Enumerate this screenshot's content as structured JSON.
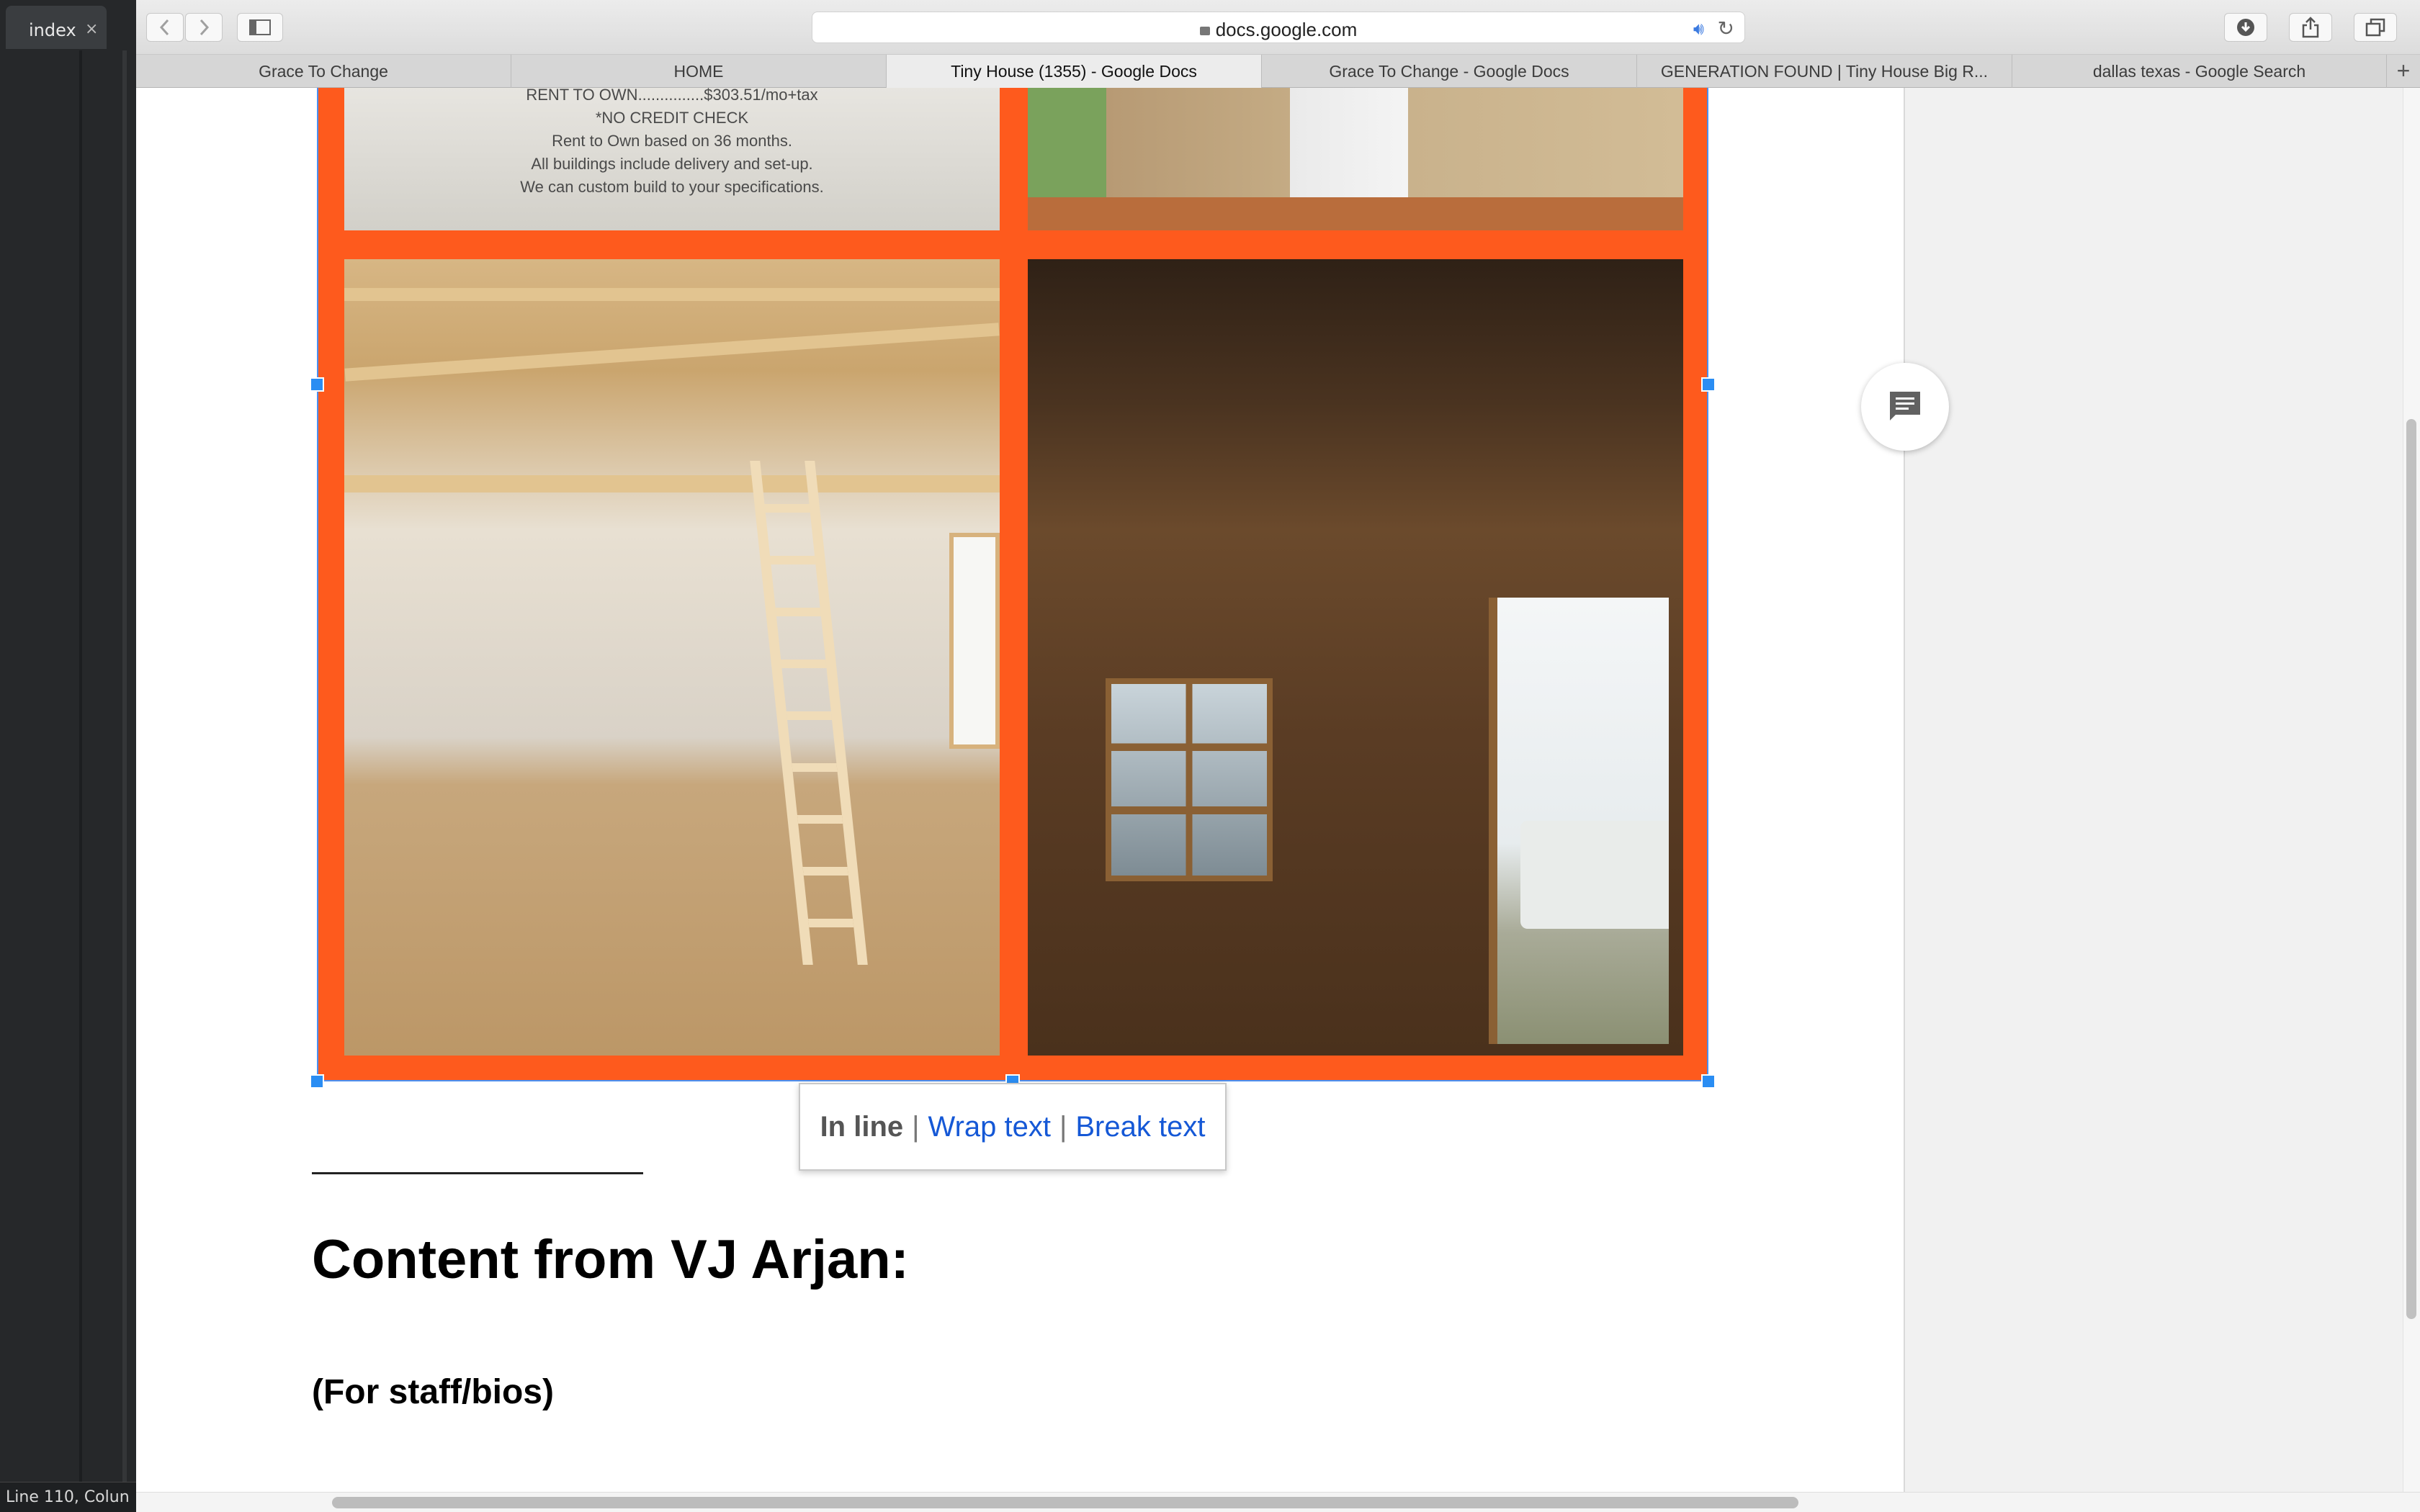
{
  "editor": {
    "tab_label": "index",
    "tab_close": "×",
    "status": "Line 110, Colun"
  },
  "browser": {
    "back_icon": "chevron-left-icon",
    "forward_icon": "chevron-right-icon",
    "url": "docs.google.com",
    "tabs": [
      {
        "label": "Grace To Change",
        "active": false
      },
      {
        "label": "HOME",
        "active": false
      },
      {
        "label": "Tiny House (1355) - Google Docs",
        "active": true
      },
      {
        "label": "Grace To Change - Google Docs",
        "active": false
      },
      {
        "label": "GENERATION FOUND | Tiny House Big R...",
        "active": false
      },
      {
        "label": "dallas texas - Google Search",
        "active": false
      }
    ],
    "new_tab": "+"
  },
  "image_sign": {
    "line1": "RENT TO OWN...............$303.51/mo+tax",
    "line2": "*NO CREDIT CHECK",
    "line3": "Rent to Own based on 36 months.",
    "line4": "All buildings include delivery and set-up.",
    "line5": "We can custom build to your specifications."
  },
  "image_popup": {
    "inline": "In line",
    "wrap": "Wrap text",
    "break": "Break text",
    "sep": "|"
  },
  "document": {
    "heading": "Content from VJ Arjan:",
    "subheading": "(For staff/bios)"
  },
  "colors": {
    "collage_frame": "#fe5a1d",
    "selection": "#2a8df3",
    "link": "#1558d6"
  }
}
